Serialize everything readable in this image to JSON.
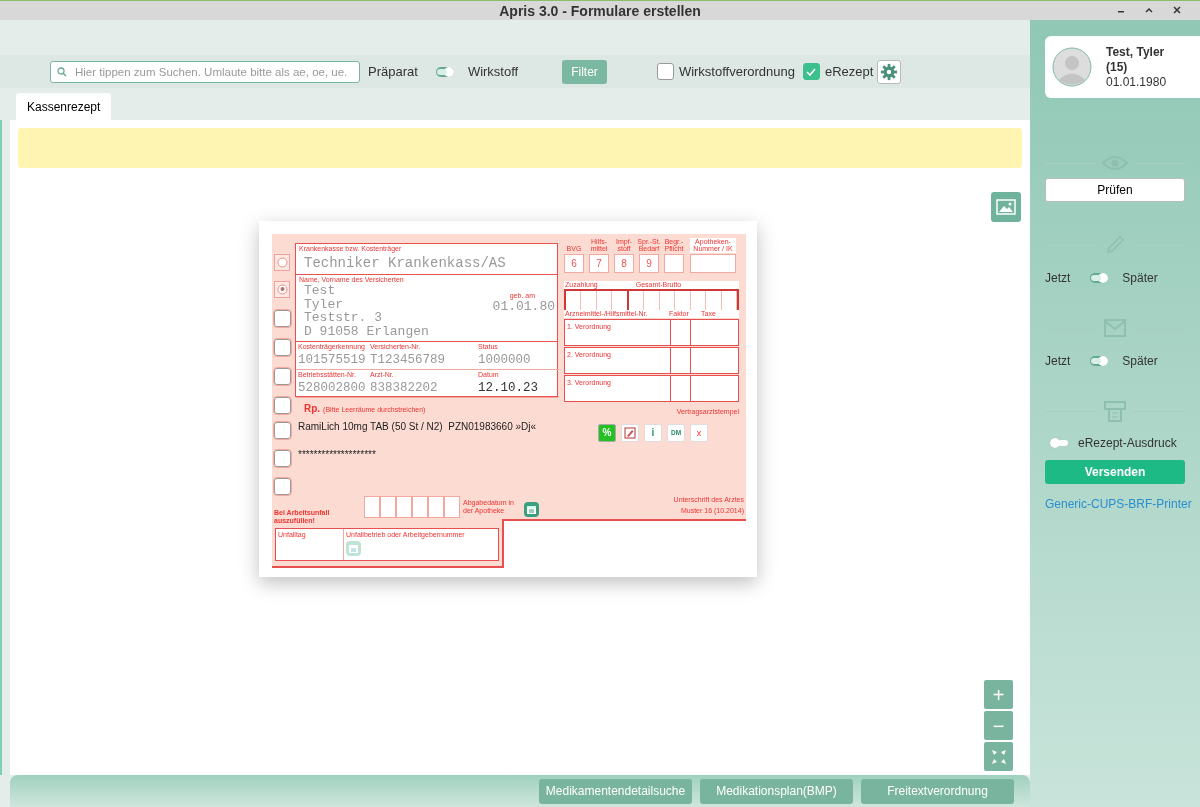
{
  "window": {
    "title": "Apris 3.0 - Formulare erstellen"
  },
  "toolbar": {
    "search": {
      "placeholder": "Hier tippen zum Suchen. Umlaute bitte als ae, oe, ue."
    },
    "mode_switch": {
      "left_label": "Präparat",
      "right_label": "Wirkstoff",
      "on": true
    },
    "filter_button": "Filter",
    "options": [
      {
        "label": "Wirkstoffverordnung",
        "checked": false
      },
      {
        "label": "eRezept",
        "checked": true
      }
    ]
  },
  "tabs": [
    {
      "label": "Kassenrezept",
      "selected": true
    }
  ],
  "form": {
    "insurer_label": "Krankenkasse bzw. Kostenträger",
    "insurer": "Techniker Krankenkass/AS",
    "name_label": "Name, Vorname des Versicherten",
    "name_lines": [
      "Test",
      "Tyler",
      "Teststr. 3",
      "D 91058 Erlangen"
    ],
    "birth_label": "geb. am",
    "birthdate": "01.01.80",
    "id_fields": [
      {
        "label": "Kostenträgerkennung",
        "value": "101575519"
      },
      {
        "label": "Versicherten-Nr.",
        "value": "T123456789"
      },
      {
        "label": "Status",
        "value": "1000000"
      },
      {
        "label": "Betriebsstätten-Nr.",
        "value": "528002800"
      },
      {
        "label": "Arzt-Nr.",
        "value": "838382202"
      },
      {
        "label": "Datum",
        "value": "12.10.23"
      }
    ],
    "side_checkboxes": [
      {
        "checked": false
      },
      {
        "checked": false
      },
      {
        "checked": false
      },
      {
        "checked": false
      }
    ],
    "rp_mark": "Rp.",
    "rp_hint": "(Bitte Leerräume durchstreichen)",
    "code_fields": [
      {
        "label": "BVG",
        "digit": "6"
      },
      {
        "label": "Hilfs-mittel",
        "digit": "7"
      },
      {
        "label": "Impf-stoff",
        "digit": "8"
      },
      {
        "label": "Spr.-St. Bedarf",
        "digit": "9"
      }
    ],
    "begr_label": "Begr.-Pflicht",
    "pharmacy_label": "Apotheken-Nummer / IK",
    "copay_label": "Zuzahlung",
    "gross_label": "Gesamt-Brutto",
    "item_no_label": "Arzneimittel-/Hilfsmittel-Nr.",
    "factor_label": "Faktor",
    "fee_label": "Taxe",
    "prescription_rows": [
      "1. Verordnung",
      "2. Verordnung",
      "3. Verordnung"
    ],
    "stamp_label": "Vertragsarztstempel",
    "lines": [
      {
        "text": "RamiLich 10mg TAB (50 St / N2)  PZN01983660 »Dj«",
        "checked": false
      },
      {
        "text": "********************",
        "checked": false
      },
      {
        "checked": false
      }
    ],
    "actions": [
      {
        "kind": "discount",
        "label": "%"
      },
      {
        "kind": "edit"
      },
      {
        "kind": "info",
        "label": "i"
      },
      {
        "kind": "dm",
        "label": "DM"
      },
      {
        "kind": "delete",
        "label": "x"
      }
    ],
    "dispense_label": "Abgabedatum in der Apotheke",
    "signature_label": "Unterschrift des Arztes",
    "form_version": "Muster 16 (10.2014)",
    "accident_label": "Bei Arbeitsunfall auszufüllen!",
    "accident_date_label": "Unfalltag",
    "employer_label": "Unfallbetrieb oder Arbeitgebernummer"
  },
  "zoom_controls": [
    {
      "kind": "in",
      "label": "+"
    },
    {
      "kind": "out",
      "label": "−"
    },
    {
      "kind": "fit"
    }
  ],
  "bottom_buttons": [
    "Medikamentendetailsuche",
    "Medikationsplan(BMP)",
    "Freitextverordnung"
  ],
  "patient": {
    "name": "Test, Tyler",
    "age": "(15)",
    "birthdate": "01.01.1980"
  },
  "side_panel": {
    "check_button": "Prüfen",
    "signature_toggle": {
      "left_label": "Jetzt",
      "right_label": "Später",
      "on": true
    },
    "send_toggle": {
      "left_label": "Jetzt",
      "right_label": "Später",
      "on": true
    },
    "print_toggle": {
      "label": "eRezept-Ausdruck",
      "on": false
    },
    "send_button": "Versenden",
    "printer_link": "Generic-CUPS-BRF-Printer"
  }
}
